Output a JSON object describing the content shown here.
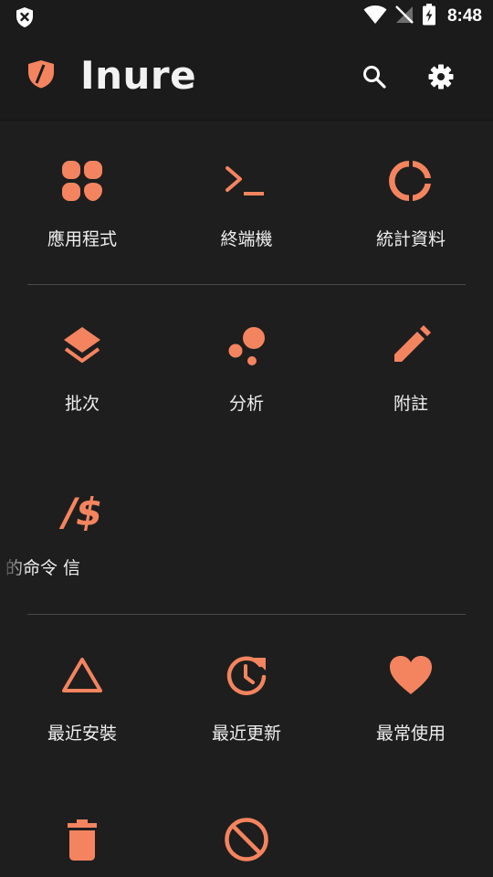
{
  "status_bar": {
    "time": "8:48"
  },
  "app": {
    "title": "Inure"
  },
  "colors": {
    "accent": "#f4845f",
    "background": "#1e1e1e",
    "divider": "#4a4a4a"
  },
  "sections": [
    {
      "items": [
        {
          "label": "應用程式",
          "icon": "apps-icon"
        },
        {
          "label": "終端機",
          "icon": "terminal-icon"
        },
        {
          "label": "統計資料",
          "icon": "statistics-icon"
        }
      ]
    },
    {
      "items": [
        {
          "label": "批次",
          "icon": "batch-layers-icon"
        },
        {
          "label": "分析",
          "icon": "analytics-icon"
        },
        {
          "label": "附註",
          "icon": "notes-pencil-icon"
        },
        {
          "label": "的命令 信",
          "icon": "command-icon",
          "icon_text": "/$"
        }
      ]
    },
    {
      "items": [
        {
          "label": "最近安裝",
          "icon": "recently-installed-icon"
        },
        {
          "label": "最近更新",
          "icon": "recently-updated-icon"
        },
        {
          "label": "最常使用",
          "icon": "most-used-heart-icon"
        },
        {
          "label": "",
          "icon": "uninstalled-trash-icon"
        },
        {
          "label": "",
          "icon": "disabled-block-icon"
        }
      ]
    }
  ]
}
